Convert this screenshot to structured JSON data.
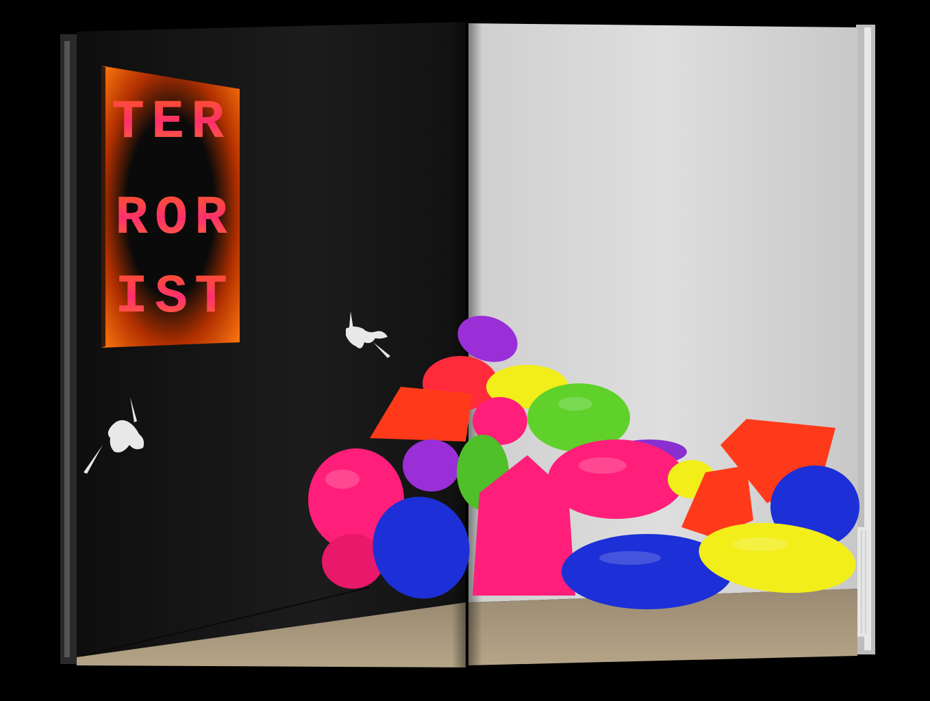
{
  "sign": {
    "lines": [
      "TER",
      "ROR",
      "IST"
    ]
  },
  "colors": {
    "background": "#000000",
    "left_wall": "#1a1a1a",
    "right_wall": "#d9d9d9",
    "floor": "#a8957a",
    "sign_orange": "#ff6a00",
    "sign_pink": "#ff2f6e",
    "bag_magenta": "#ff1f7a",
    "bag_blue": "#1d2fd6",
    "bag_yellow": "#f2ee1a",
    "bag_green": "#5fd12a",
    "bag_orange": "#ff3a1a",
    "bag_purple": "#9a2fd8"
  },
  "icons": {
    "paint_splatter": "splatter-icon"
  }
}
